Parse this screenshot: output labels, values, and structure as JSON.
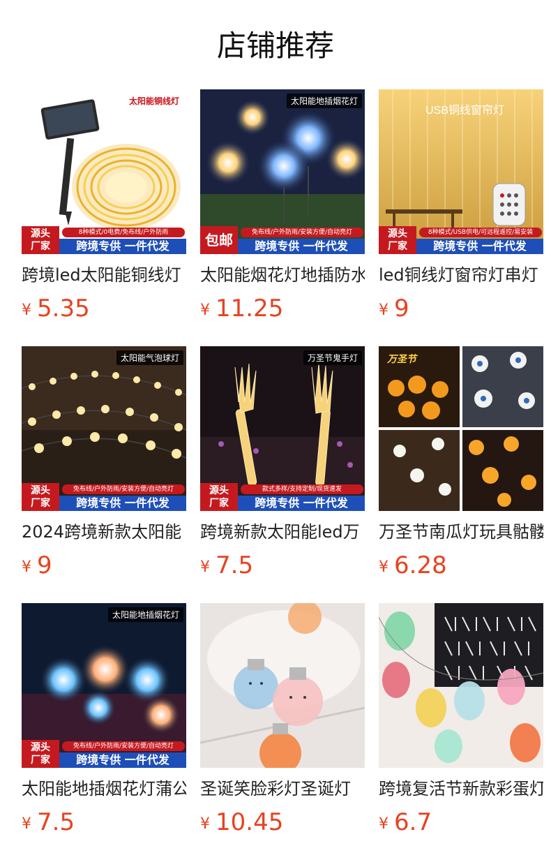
{
  "header": {
    "title": "店铺推荐"
  },
  "currency_symbol": "¥",
  "products": [
    {
      "name": "跨境led太阳能铜线灯",
      "price": "5.35",
      "image_tag": "太阳能铜线灯",
      "banner": {
        "left": "源头厂家",
        "top": "8种模式/0电费/免布线/户外防雨",
        "bottom": "跨境专供 一件代发"
      }
    },
    {
      "name": "太阳能烟花灯地插防水",
      "price": "11.25",
      "image_tag": "太阳能地插烟花灯",
      "banner": {
        "left": "包邮",
        "top": "免布线/户外防雨/安装方便/自动亮灯",
        "bottom": "跨境专供 一件代发"
      }
    },
    {
      "name": "led铜线灯窗帘灯串灯",
      "price": "9",
      "image_tag": "USB铜线窗帘灯",
      "banner": {
        "left": "源头厂家",
        "top": "8种模式/USB供电/可远程遥控/易安装",
        "bottom": "跨境专供 一件代发"
      }
    },
    {
      "name": "2024跨境新款太阳能",
      "price": "9",
      "image_tag": "太阳能气泡球灯",
      "banner": {
        "left": "源头厂家",
        "top": "免布线/户外防雨/安装方便/自动亮灯",
        "bottom": "跨境专供 一件代发"
      }
    },
    {
      "name": "跨境新款太阳能led万",
      "price": "7.5",
      "image_tag": "万圣节鬼手灯",
      "banner": {
        "left": "源头厂家",
        "top": "款式多样/支持定制/现货速发",
        "bottom": "跨境专供 一件代发"
      }
    },
    {
      "name": "万圣节南瓜灯玩具骷髅",
      "price": "6.28",
      "image_tag": "万圣节",
      "banner": null
    },
    {
      "name": "太阳能地插烟花灯蒲公",
      "price": "7.5",
      "image_tag": "太阳能地插烟花灯",
      "banner": {
        "left": "源头厂家",
        "top": "免布线/户外防雨/安装方便/自动亮灯",
        "bottom": "跨境专供 一件代发"
      }
    },
    {
      "name": "圣诞笑脸彩灯圣诞灯",
      "price": "10.45",
      "image_tag": "",
      "banner": null
    },
    {
      "name": "跨境复活节新款彩蛋灯",
      "price": "6.7",
      "image_tag": "",
      "banner": null
    }
  ]
}
